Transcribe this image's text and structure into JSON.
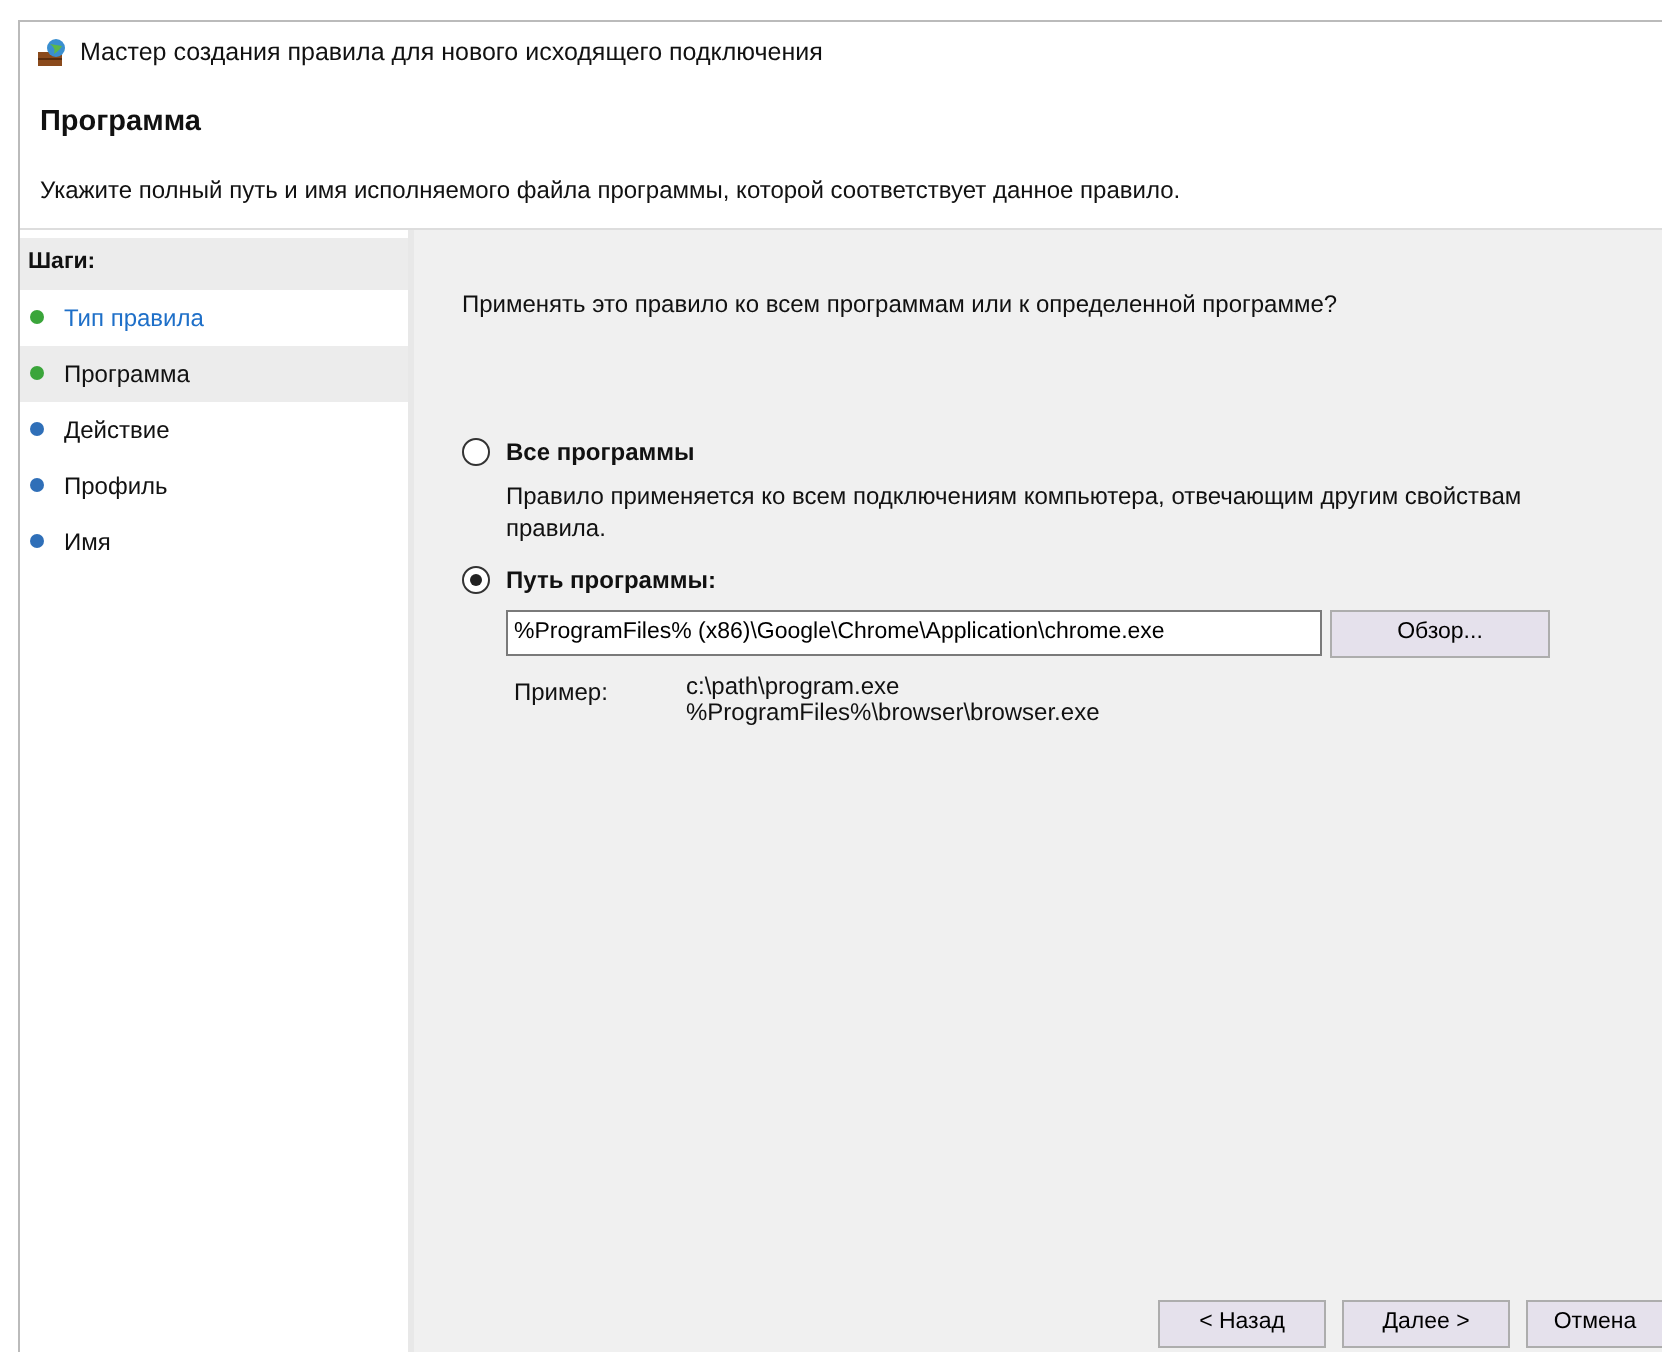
{
  "window": {
    "title": "Мастер создания правила для нового исходящего подключения"
  },
  "header": {
    "title": "Программа",
    "description": "Укажите полный путь и имя исполняемого файла программы, которой соответствует данное правило."
  },
  "steps": {
    "heading": "Шаги:",
    "items": [
      {
        "label": "Тип правила",
        "done": true,
        "kind": "link",
        "selected": false
      },
      {
        "label": "Программа",
        "done": true,
        "kind": "text",
        "selected": true
      },
      {
        "label": "Действие",
        "done": false,
        "kind": "text",
        "selected": false
      },
      {
        "label": "Профиль",
        "done": false,
        "kind": "text",
        "selected": false
      },
      {
        "label": "Имя",
        "done": false,
        "kind": "text",
        "selected": false
      }
    ]
  },
  "question": "Применять это правило ко всем программам или к определенной программе?",
  "options": [
    {
      "label": "Все программы",
      "description": "Правило применяется ко всем подключениям компьютера, отвечающим другим свойствам правила.",
      "selected": false
    },
    {
      "label": "Путь программы:",
      "selected": true,
      "path": {
        "value": "%ProgramFiles% (x86)\\Google\\Chrome\\Application\\chrome.exe",
        "browse_button": "Обзор..."
      },
      "example": {
        "label": "Пример:",
        "lines": [
          "c:\\path\\program.exe",
          "%ProgramFiles%\\browser\\browser.exe"
        ]
      }
    }
  ],
  "buttons": [
    "< Назад",
    "Далее >",
    "Отмена"
  ]
}
